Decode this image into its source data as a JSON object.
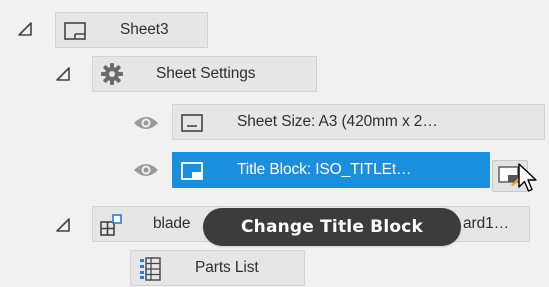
{
  "tree": {
    "sheet": {
      "label": "Sheet3",
      "icon": "sheet-icon"
    },
    "sheet_settings": {
      "label": "Sheet Settings",
      "icon": "gear-icon"
    },
    "sheet_size": {
      "label": "Sheet Size: A3 (420mm x 2…",
      "icon": "sheet-icon"
    },
    "title_block": {
      "label": "Title Block: ISO_TITLEt…",
      "icon": "title-block-icon"
    },
    "blade": {
      "label_left": "blade",
      "label_right": "ard1…",
      "icon": "view-tree-icon"
    },
    "parts_list": {
      "label": "Parts List",
      "icon": "parts-list-icon"
    }
  },
  "tooltip": {
    "text": "Change Title Block"
  },
  "colors": {
    "background": "#f1f1f1",
    "selected": "#1a8fde",
    "tooltip_bg": "#3c3c3c",
    "icon_gray": "#555555"
  }
}
